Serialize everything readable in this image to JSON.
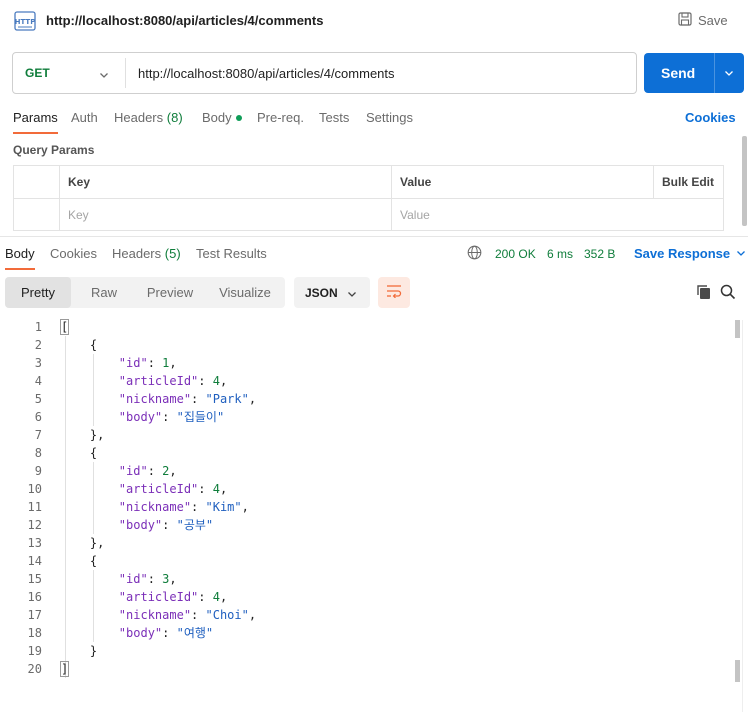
{
  "window": {
    "title": "http://localhost:8080/api/articles/4/comments",
    "save_label": "Save"
  },
  "request": {
    "method": "GET",
    "url": "http://localhost:8080/api/articles/4/comments",
    "send_label": "Send"
  },
  "req_tabs": {
    "params": "Params",
    "auth": "Auth",
    "headers": "Headers",
    "headers_count": "(8)",
    "body": "Body",
    "prereq": "Pre-req.",
    "tests": "Tests",
    "settings": "Settings",
    "cookies": "Cookies"
  },
  "query_params": {
    "title": "Query Params",
    "columns": [
      "Key",
      "Value",
      "Bulk Edit"
    ],
    "placeholders": {
      "key": "Key",
      "value": "Value"
    }
  },
  "response": {
    "tabs": {
      "body": "Body",
      "cookies": "Cookies",
      "headers": "Headers",
      "headers_count": "(5)",
      "test_results": "Test Results"
    },
    "status": "200 OK",
    "time": "6 ms",
    "size": "352 B",
    "save_response": "Save Response",
    "views": [
      "Pretty",
      "Raw",
      "Preview",
      "Visualize"
    ],
    "format": "JSON"
  },
  "colors": {
    "accent": "#0d6fd6",
    "active_tab": "#f26b3a",
    "status_ok": "#0f7d3b"
  },
  "comments": [
    {
      "id": "1",
      "articleId": "4",
      "nickname": "\"Park\"",
      "body": "\"집들이\""
    },
    {
      "id": "2",
      "articleId": "4",
      "nickname": "\"Kim\"",
      "body": "\"공부\""
    },
    {
      "id": "3",
      "articleId": "4",
      "nickname": "\"Choi\"",
      "body": "\"여행\""
    }
  ],
  "json_keys": {
    "id": "\"id\"",
    "articleId": "\"articleId\"",
    "nickname": "\"nickname\"",
    "body": "\"body\""
  }
}
